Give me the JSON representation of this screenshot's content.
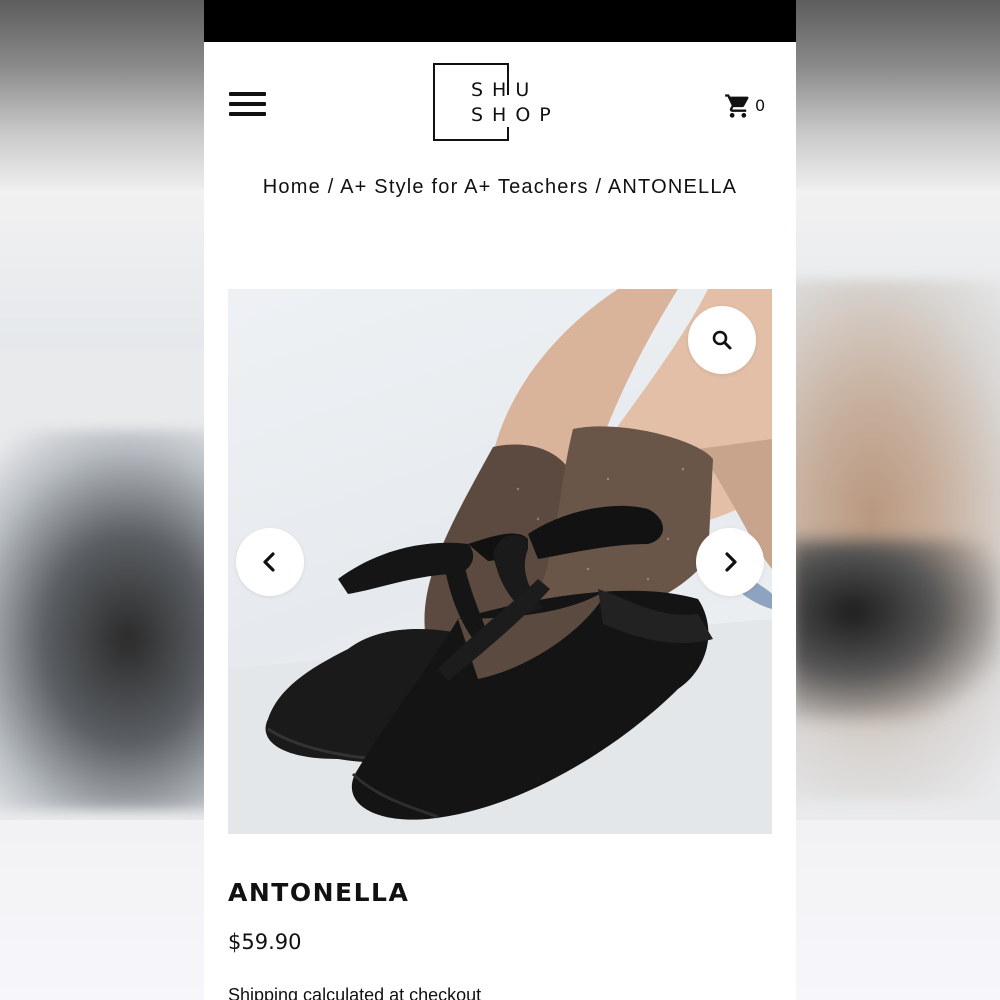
{
  "header": {
    "logo_line1": "SHU",
    "logo_line2": "SHOP",
    "cart_count": "0",
    "menu_icon": "hamburger-menu-icon",
    "cart_icon": "shopping-cart-icon"
  },
  "breadcrumb": {
    "items": [
      "Home",
      "A+ Style for A+ Teachers",
      "ANTONELLA"
    ],
    "separator": "/"
  },
  "gallery": {
    "zoom_icon": "magnifier-icon",
    "prev_icon": "chevron-left-icon",
    "next_icon": "chevron-right-icon"
  },
  "product": {
    "name": "ANTONELLA",
    "price": "$59.90",
    "shipping_note": "Shipping calculated at checkout"
  },
  "colors": {
    "status_bar": "#000000",
    "text": "#111111",
    "background": "#ffffff"
  }
}
